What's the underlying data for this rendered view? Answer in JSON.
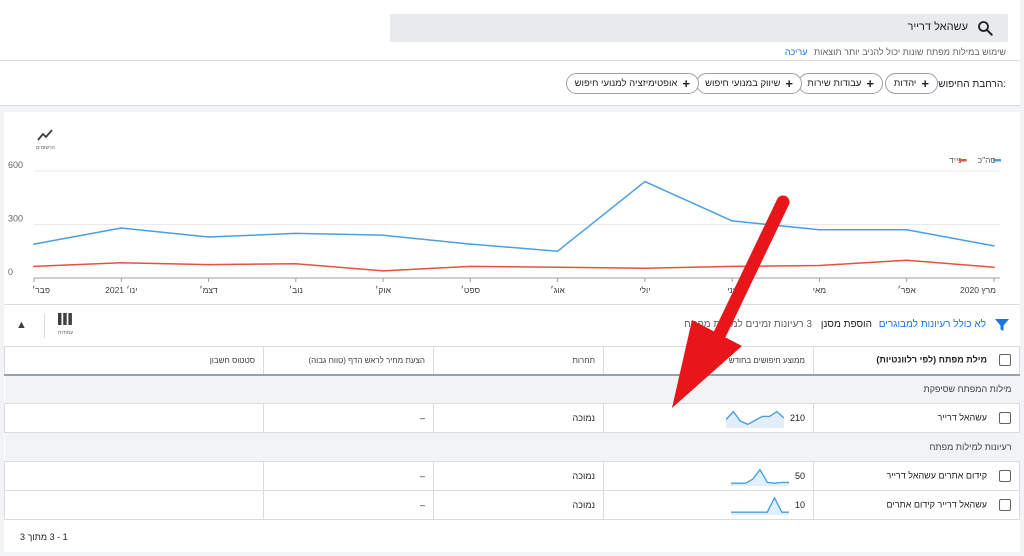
{
  "search": {
    "query": "עשהאל דרייר",
    "hint": "שימוש במילות מפתח שונות יכול להניב יותר תוצאות",
    "edit_label": "עריכה"
  },
  "broaden": {
    "label": "הרחבת החיפוש:",
    "chips": [
      "יהדות",
      "עבודות שירות",
      "שיווק במנועי חיפוש",
      "אופטימיזציה למנועי חיפוש"
    ]
  },
  "chart_header": {
    "icon_label": "הרשומים"
  },
  "chart_data": {
    "type": "line",
    "categories": [
      "מרץ 2020",
      "אפר׳",
      "מאי",
      "יוני",
      "יולי",
      "אוג׳",
      "ספט׳",
      "אוק׳",
      "נוב׳",
      "דצמ׳",
      "ינו׳ 2021",
      "פבר׳"
    ],
    "series": [
      {
        "name": "סה\"כ",
        "color": "#4a9fe0",
        "values": [
          180,
          270,
          270,
          320,
          540,
          150,
          190,
          240,
          250,
          230,
          280,
          190
        ]
      },
      {
        "name": "נייד",
        "color": "#e5533d",
        "values": [
          60,
          100,
          70,
          65,
          55,
          60,
          65,
          40,
          80,
          75,
          85,
          65
        ]
      }
    ],
    "yticks": [
      0,
      300,
      600
    ],
    "ylim": [
      0,
      650
    ],
    "grid": true,
    "legend": "top-right"
  },
  "toolbar": {
    "filter_label": "לא כולל רעיונות למבוגרים",
    "add_negative_label": "הוספת מסנן",
    "ideas_count_label": "3 רעיונות זמינים למילות מפתח",
    "columns_label": "עמודות"
  },
  "table": {
    "headers": [
      "מילת מפתח (לפי רלוונטיות)",
      "ממוצע חיפושים בחודש",
      "תחרות",
      "הצעת מחיר לראש הדף (טווח גבוה)",
      "סטטוס חשבון"
    ],
    "groups": [
      {
        "title": "מילות המפתח שסיפקת",
        "rows": [
          {
            "keyword": "עשהאל דרייר",
            "avg": "210",
            "competition": "נמוכה",
            "bid": "–",
            "status": "",
            "spark": [
              0.4,
              0.9,
              0.3,
              0.1,
              0.35,
              0.6,
              0.6,
              0.9,
              0.5
            ]
          }
        ]
      },
      {
        "title": "רעיונות למילות מפתח",
        "rows": [
          {
            "keyword": "קידום אתרים עשהאל דרייר",
            "avg": "50",
            "competition": "נמוכה",
            "bid": "–",
            "status": "",
            "spark": [
              0.05,
              0.05,
              0.05,
              0.3,
              0.9,
              0.1,
              0.05,
              0.1,
              0.1
            ]
          },
          {
            "keyword": "עשהאל דרייר קידום אתרים",
            "avg": "10",
            "competition": "נמוכה",
            "bid": "–",
            "status": "",
            "spark": [
              0.05,
              0.05,
              0.05,
              0.05,
              0.05,
              0.05,
              0.95,
              0.05,
              0.05
            ]
          }
        ]
      }
    ]
  },
  "pager": "1 - 3 מתוך 3",
  "colors": {
    "total_series": "#4a9fe0",
    "mobile_series": "#e5533d",
    "annotation_arrow": "#e8161b",
    "link": "#1a73e8"
  }
}
